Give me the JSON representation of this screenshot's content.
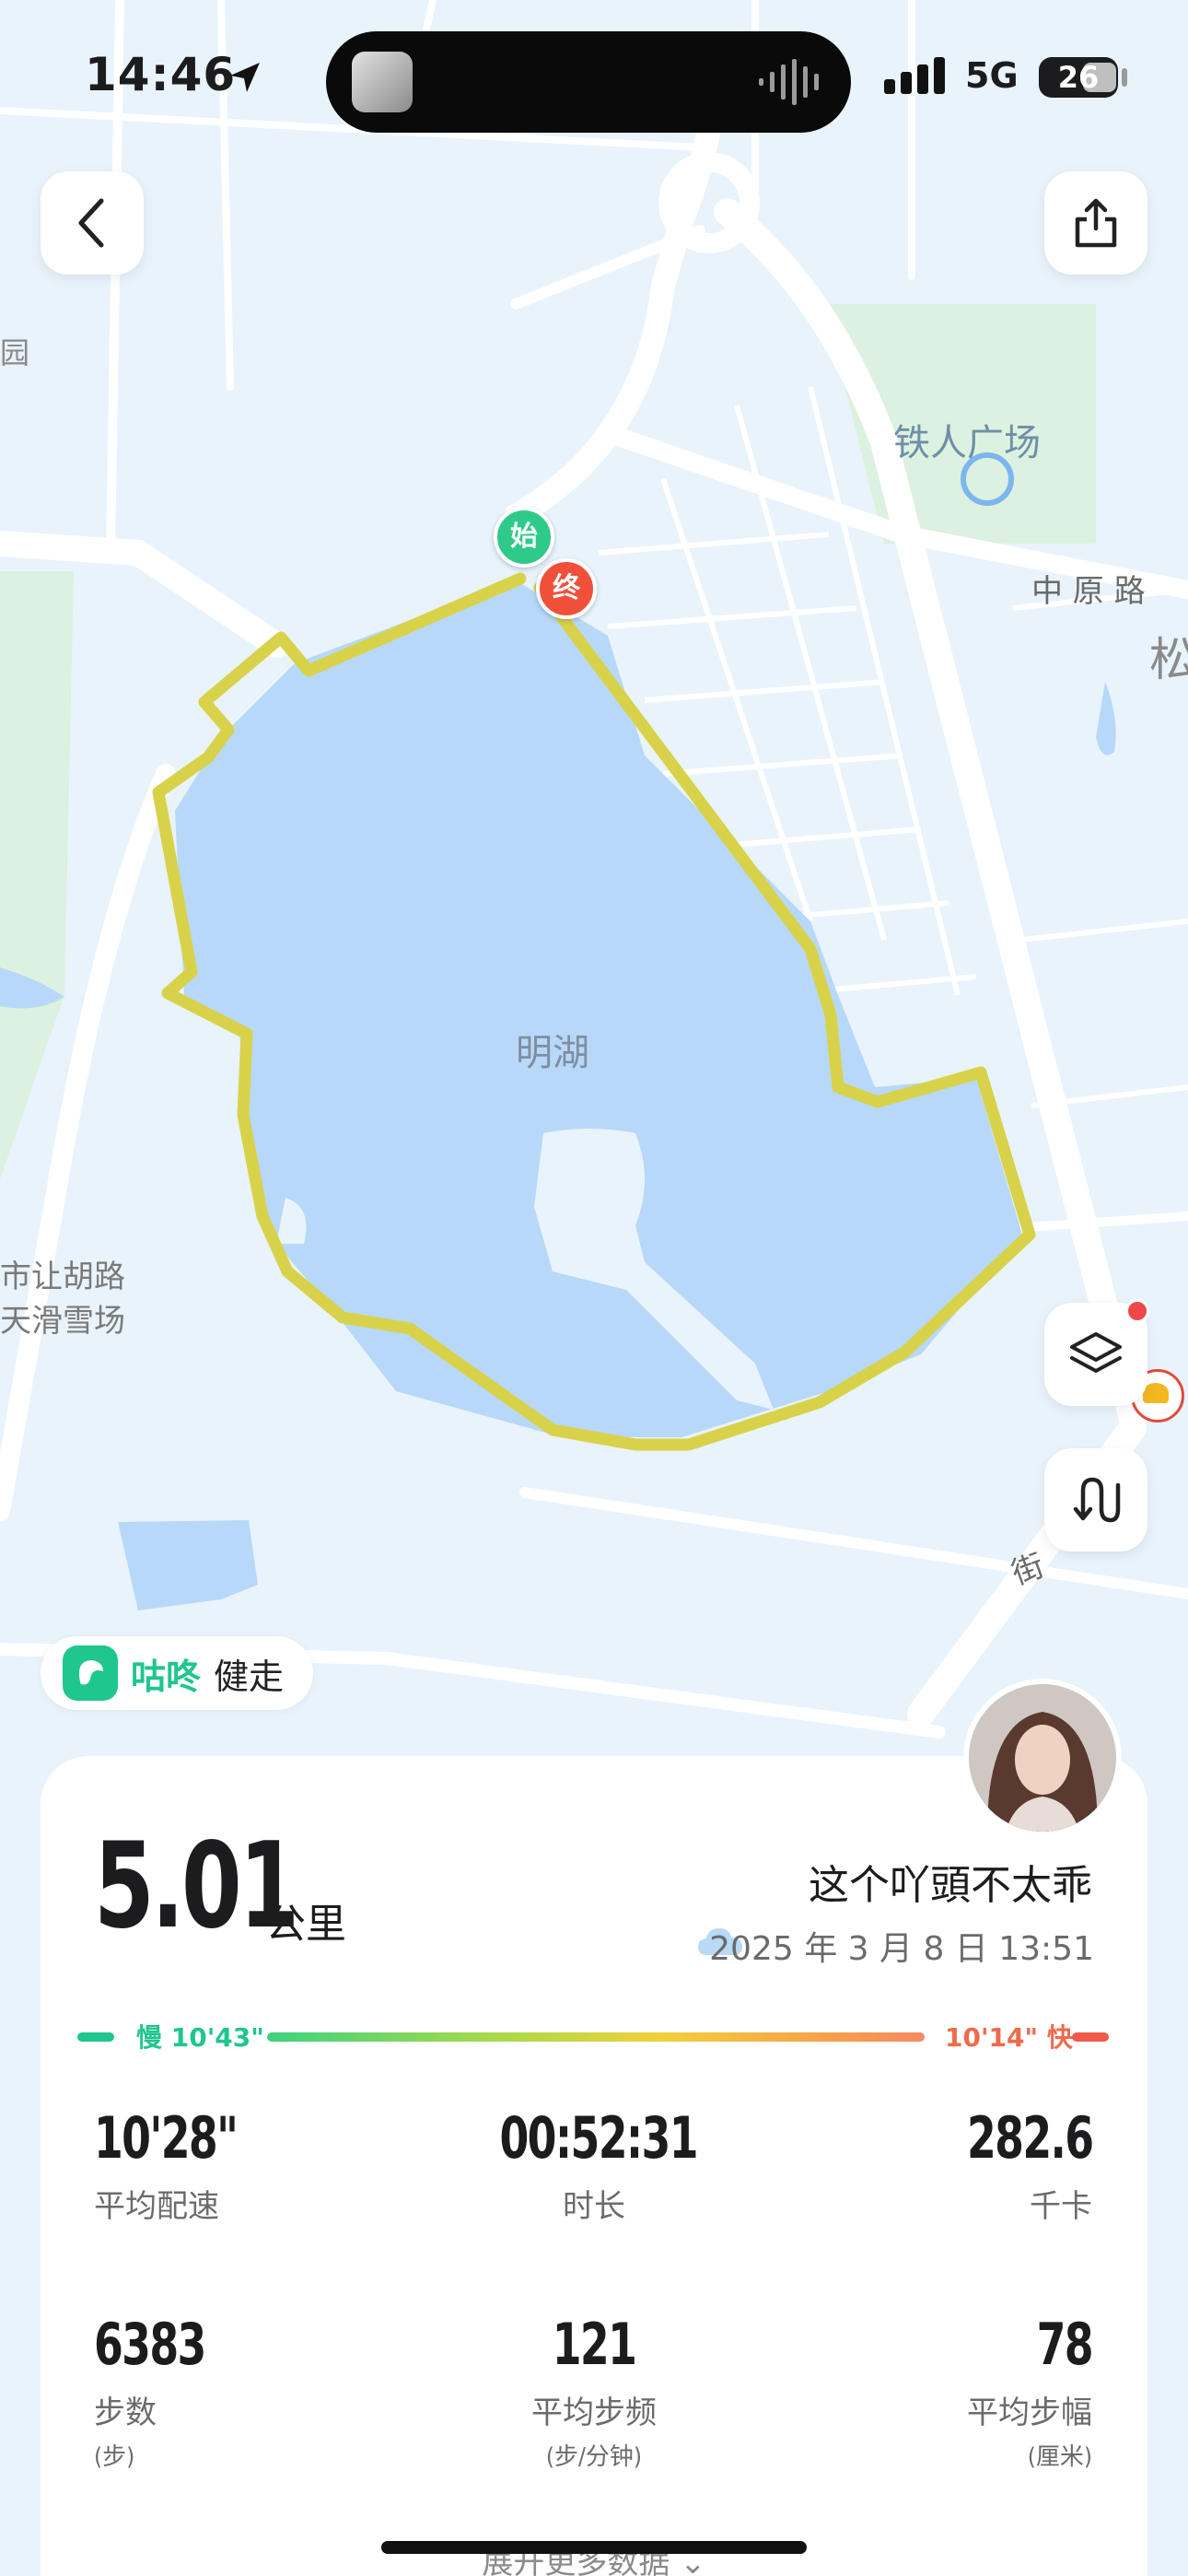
{
  "status_bar": {
    "time": "14:46",
    "network": "5G",
    "battery": "26"
  },
  "map": {
    "labels": {
      "lake": "明湖",
      "plaza": "铁人广场",
      "road_zhongyuan": "中 原 路",
      "road_rangtu": "市让胡路",
      "ski": "天滑雪场",
      "park_frag": "园",
      "song_frag": "松",
      "street_frag": "街"
    },
    "start_marker": "始",
    "end_marker": "终",
    "colors": {
      "water": "#b7d8f8",
      "route": "#d8d24a",
      "park": "#dcf1e0",
      "road": "#ffffff",
      "background": "#e9f3fb"
    }
  },
  "icons": [
    "back-icon",
    "share-icon",
    "layers-icon",
    "route-toggle-icon",
    "location-arrow-icon",
    "cloud-icon"
  ],
  "brand": {
    "name": "咕咚",
    "mode": "健走"
  },
  "summary": {
    "distance": "5.01",
    "distance_unit": "公里",
    "nickname": "这个吖頭不太乖",
    "datetime": "2025 年 3 月 8 日 13:51",
    "pace_slow": "慢 10'43\"",
    "pace_fast": "10'14\" 快"
  },
  "stats": [
    {
      "value": "10'28\"",
      "label": "平均配速",
      "sub": ""
    },
    {
      "value": "00:52:31",
      "label": "时长",
      "sub": ""
    },
    {
      "value": "282.6",
      "label": "千卡",
      "sub": ""
    },
    {
      "value": "6383",
      "label": "步数",
      "sub": "(步)"
    },
    {
      "value": "121",
      "label": "平均步频",
      "sub": "(步/分钟)"
    },
    {
      "value": "78",
      "label": "平均步幅",
      "sub": "(厘米)"
    }
  ],
  "footer": {
    "more": "展开更多数据"
  }
}
